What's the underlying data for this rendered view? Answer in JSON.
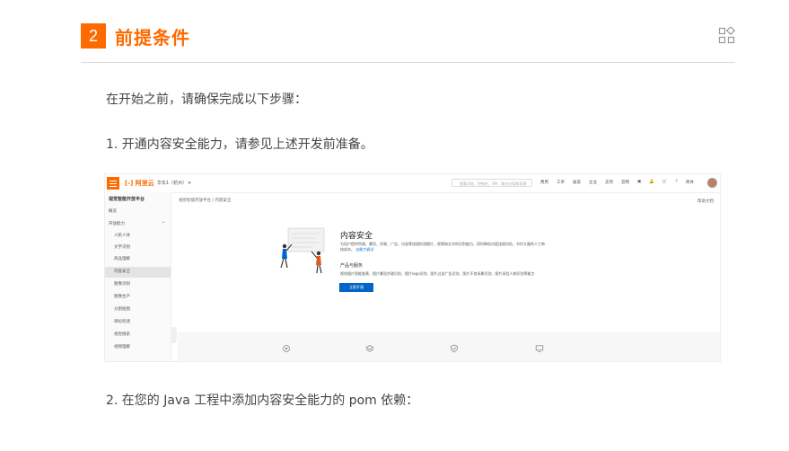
{
  "section": {
    "number": "2",
    "title": "前提条件",
    "icon": "layout-grid-icon"
  },
  "paragraphs": {
    "intro": "在开始之前，请确保完成以下步骤：",
    "step1": "1. 开通内容安全能力，请参见上述开发前准备。",
    "step2": "2. 在您的 Java 工程中添加内容安全能力的 pom 依赖："
  },
  "screenshot": {
    "logo": "[-] 阿里云",
    "workspace": "华东1（杭州） ▾",
    "search_placeholder": "搜索文档、控制台、API、解决方案和资源",
    "top_nav": [
      "费用",
      "工单",
      "备案",
      "企业",
      "支持",
      "官网",
      "▣",
      "🔔",
      "🛒",
      "?",
      "简体"
    ],
    "sidebar": {
      "title": "视觉智能开放平台",
      "items": [
        {
          "label": "概览",
          "level": 0
        },
        {
          "label": "开放能力",
          "level": 0,
          "suffix": "^"
        },
        {
          "label": "人脸人体",
          "level": 1
        },
        {
          "label": "文字识别",
          "level": 1
        },
        {
          "label": "商品理解",
          "level": 1
        },
        {
          "label": "内容安全",
          "level": 1,
          "active": true
        },
        {
          "label": "图像识别",
          "level": 1
        },
        {
          "label": "图像生产",
          "level": 1
        },
        {
          "label": "分割抠图",
          "level": 1
        },
        {
          "label": "目标检测",
          "level": 1
        },
        {
          "label": "视觉搜索",
          "level": 1
        },
        {
          "label": "视频理解",
          "level": 1
        }
      ]
    },
    "breadcrumb": "视觉智能开放平台 / 内容安全",
    "help": "帮助文档",
    "card": {
      "title": "内容安全",
      "desc": "为用户提供色情、暴恐、涉政、广告、垃圾等违规检测图片、视频和文字的识别能力，同时降低内容违规风险，节约大量的人工审核成本。",
      "desc_link": "去能力调试",
      "sub": "产品与服务",
      "features": "视觉图片智能鉴黄、图片暴恐涉政识别、图片logo识别、图片过滤广告识别、图片不良场景识别、图片风险人物识别等能力",
      "button": "立即开通"
    },
    "bottom_icons": [
      "target-icon",
      "layers-icon",
      "shield-check-icon",
      "monitor-icon"
    ]
  },
  "colors": {
    "accent": "#ff6a00",
    "link": "#0070cc",
    "button": "#0064c8"
  }
}
